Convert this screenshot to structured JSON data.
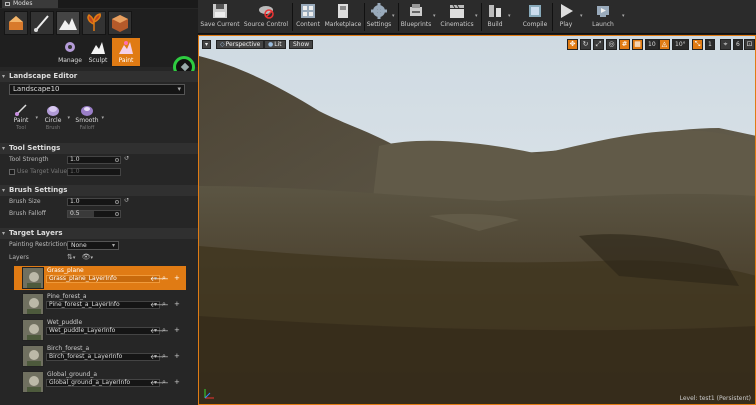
{
  "modes_tab": {
    "title": "Modes"
  },
  "mode_tools": [
    {
      "label": "Manage"
    },
    {
      "label": "Sculpt"
    },
    {
      "label": "Paint"
    }
  ],
  "landscape_editor": {
    "header": "Landscape Editor",
    "selected_landscape": "Landscape10",
    "brushes": [
      {
        "label": "Paint",
        "sub": "Tool"
      },
      {
        "label": "Circle",
        "sub": "Brush"
      },
      {
        "label": "Smooth",
        "sub": "Falloff"
      }
    ]
  },
  "tool_settings": {
    "header": "Tool Settings",
    "tool_strength_label": "Tool Strength",
    "tool_strength_value": "1.0",
    "use_target_value_label": "Use Target Value",
    "target_value": "1.0"
  },
  "brush_settings": {
    "header": "Brush Settings",
    "brush_size_label": "Brush Size",
    "brush_size_value": "1.0",
    "brush_falloff_label": "Brush Falloff",
    "brush_falloff_value": "0.5",
    "brush_falloff_fraction": 0.5
  },
  "target_layers": {
    "header": "Target Layers",
    "painting_restriction_label": "Painting Restriction",
    "painting_restriction_value": "None",
    "layers_label": "Layers",
    "layers": [
      {
        "name": "Grass_plane",
        "info": "Grass_plane_LayerInfo",
        "selected": true
      },
      {
        "name": "Pine_forest_a",
        "info": "Pine_forest_a_LayerInfo",
        "selected": false
      },
      {
        "name": "Wet_puddle",
        "info": "Wet_puddle_LayerInfo",
        "selected": false
      },
      {
        "name": "Birch_forest_a",
        "info": "Birch_forest_a_LayerInfo",
        "selected": false
      },
      {
        "name": "Global_ground_a",
        "info": "Global_ground_a_LayerInfo",
        "selected": false
      }
    ]
  },
  "toolbar": {
    "save_current": "Save Current",
    "source_control": "Source Control",
    "content": "Content",
    "marketplace": "Marketplace",
    "settings": "Settings",
    "blueprints": "Blueprints",
    "cinematics": "Cinematics",
    "build": "Build",
    "compile": "Compile",
    "play": "Play",
    "launch": "Launch"
  },
  "viewport": {
    "perspective": "Perspective",
    "lit": "Lit",
    "show": "Show",
    "grid_snap": "10",
    "rotation_snap": "10°",
    "scale_snap": "1",
    "camera_speed": "6",
    "level_label": "Level:  test1 (Persistent)"
  },
  "colors": {
    "accent": "#e07b14",
    "panel": "#262626",
    "toolbar": "#2b2b2b"
  }
}
